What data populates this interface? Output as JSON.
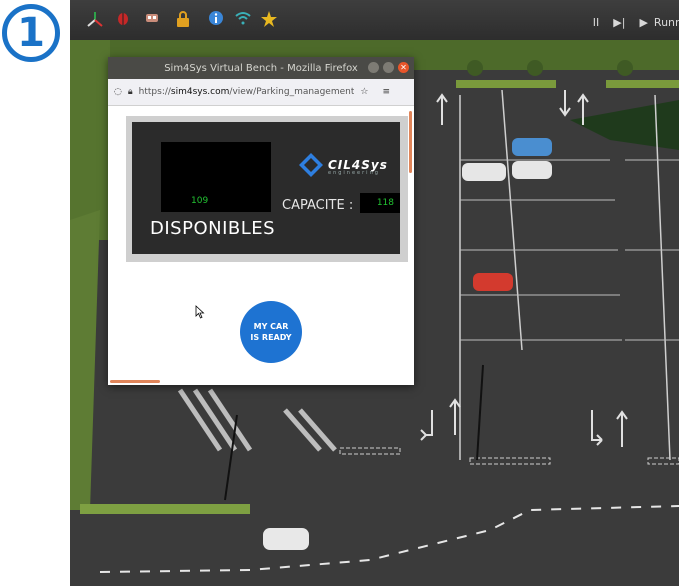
{
  "step_number": "1",
  "simulator": {
    "toolbar_icons": [
      "axes-icon",
      "bug-icon",
      "robot-icon",
      "lock-icon",
      "info-icon",
      "wifi-icon",
      "star-icon"
    ],
    "controls": {
      "pause": "II",
      "step": "▶|",
      "play": "▶",
      "status": "Running"
    }
  },
  "browser": {
    "title": "Sim4Sys Virtual Bench - Mozilla Firefox",
    "url_prefix": "https://",
    "url_domain": "sim4sys.com",
    "url_path": "/view/Parking_management"
  },
  "dashboard": {
    "available_count": "109",
    "capacity_label": "CAPACITE :",
    "capacity_value": "118",
    "available_label": "DISPONIBLES",
    "logo_text": "CIL4Sys",
    "logo_subtext": "engineering",
    "car_ready_button": "MY CAR\nIS READY"
  },
  "colors": {
    "badge": "#1a72c7",
    "button": "#1e73d2",
    "digits": "#22c232",
    "asphalt": "#3b3b3b",
    "grass": "#5b7a33"
  }
}
